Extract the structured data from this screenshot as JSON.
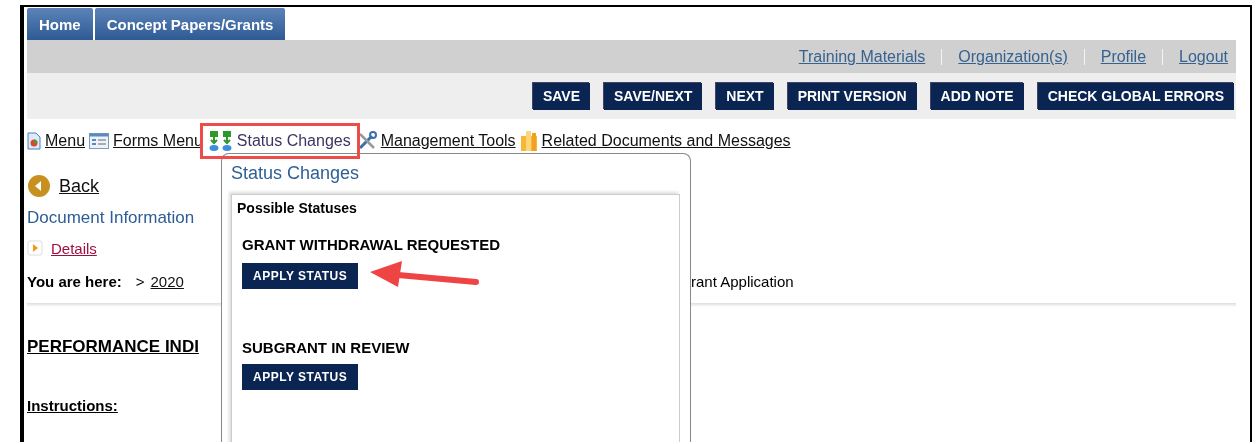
{
  "nav_tabs": [
    {
      "label": "Home"
    },
    {
      "label": "Concept Papers/Grants"
    }
  ],
  "header_links": [
    "Training Materials",
    "Organization(s)",
    "Profile",
    "Logout"
  ],
  "action_buttons": [
    "SAVE",
    "SAVE/NEXT",
    "NEXT",
    "PRINT VERSION",
    "ADD NOTE",
    "CHECK GLOBAL ERRORS"
  ],
  "toolbar": [
    {
      "label": "Menu",
      "kind": "document",
      "highlighted": false
    },
    {
      "label": "Forms Menu",
      "kind": "form",
      "highlighted": false
    },
    {
      "label": "Status Changes",
      "kind": "status",
      "highlighted": true
    },
    {
      "label": "Management Tools",
      "kind": "tools",
      "highlighted": false
    },
    {
      "label": "Related Documents and Messages",
      "kind": "folder",
      "highlighted": false
    }
  ],
  "back_link": "Back",
  "section_title": "Document Information",
  "details_link": "Details",
  "breadcrumb": {
    "label": "You are here:",
    "separator": ">",
    "link": "2020",
    "tail": "rant Application"
  },
  "page_heading": "PERFORMANCE INDI",
  "instructions_label": "Instructions:",
  "status_popup": {
    "title": "Status Changes",
    "subtitle": "Possible Statuses",
    "statuses": [
      {
        "name": "GRANT WITHDRAWAL REQUESTED",
        "button": "APPLY STATUS",
        "pointed": true
      },
      {
        "name": "SUBGRANT IN REVIEW",
        "button": "APPLY STATUS",
        "pointed": false
      }
    ]
  }
}
